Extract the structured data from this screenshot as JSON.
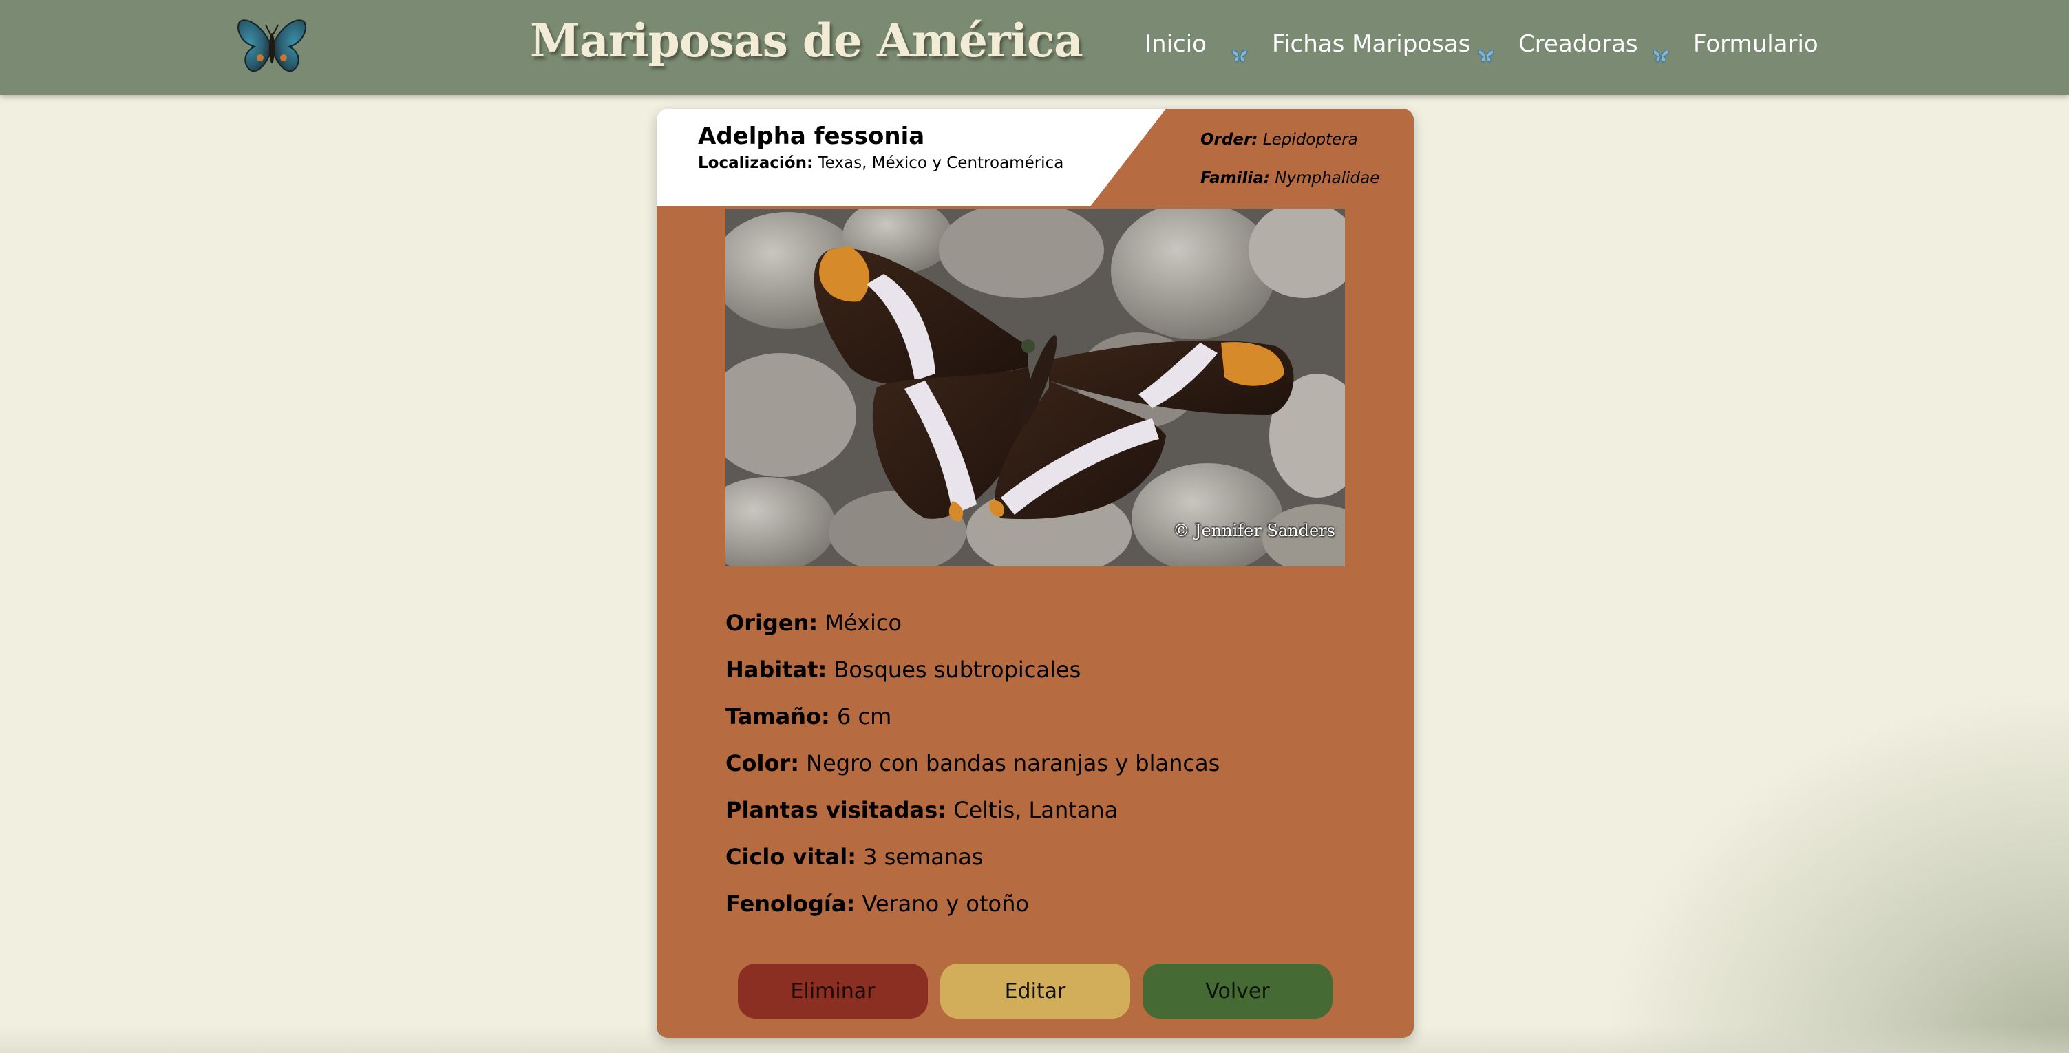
{
  "header": {
    "title": "Mariposas de América",
    "logo_icon": "butterfly-logo-icon",
    "nav": [
      {
        "label": "Inicio"
      },
      {
        "label": "Fichas Mariposas"
      },
      {
        "label": "Creadoras"
      },
      {
        "label": "Formulario"
      }
    ],
    "separator_icon": "small-butterfly-icon"
  },
  "card": {
    "species": "Adelpha fessonia",
    "location_label": "Localización:",
    "location_value": "Texas, México y Centroamérica",
    "order_label": "Order:",
    "order_value": "Lepidoptera",
    "family_label": "Familia:",
    "family_value": "Nymphalidae",
    "photo_credit": "© Jennifer Sanders",
    "facts": [
      {
        "label": "Origen:",
        "value": "México"
      },
      {
        "label": "Habitat:",
        "value": "Bosques subtropicales"
      },
      {
        "label": "Tamaño:",
        "value": "6 cm"
      },
      {
        "label": "Color:",
        "value": "Negro con bandas naranjas y blancas"
      },
      {
        "label": "Plantas visitadas:",
        "value": "Celtis, Lantana"
      },
      {
        "label": "Ciclo vital:",
        "value": "3 semanas"
      },
      {
        "label": "Fenología:",
        "value": "Verano y otoño"
      }
    ],
    "buttons": {
      "delete": "Eliminar",
      "edit": "Editar",
      "back": "Volver"
    }
  },
  "colors": {
    "header_bg": "#7b8b73",
    "page_bg": "#f1efe0",
    "card_bg": "#b66b40",
    "delete_bg": "#8c2f23",
    "edit_bg": "#d2ad5a",
    "back_bg": "#456a33"
  }
}
